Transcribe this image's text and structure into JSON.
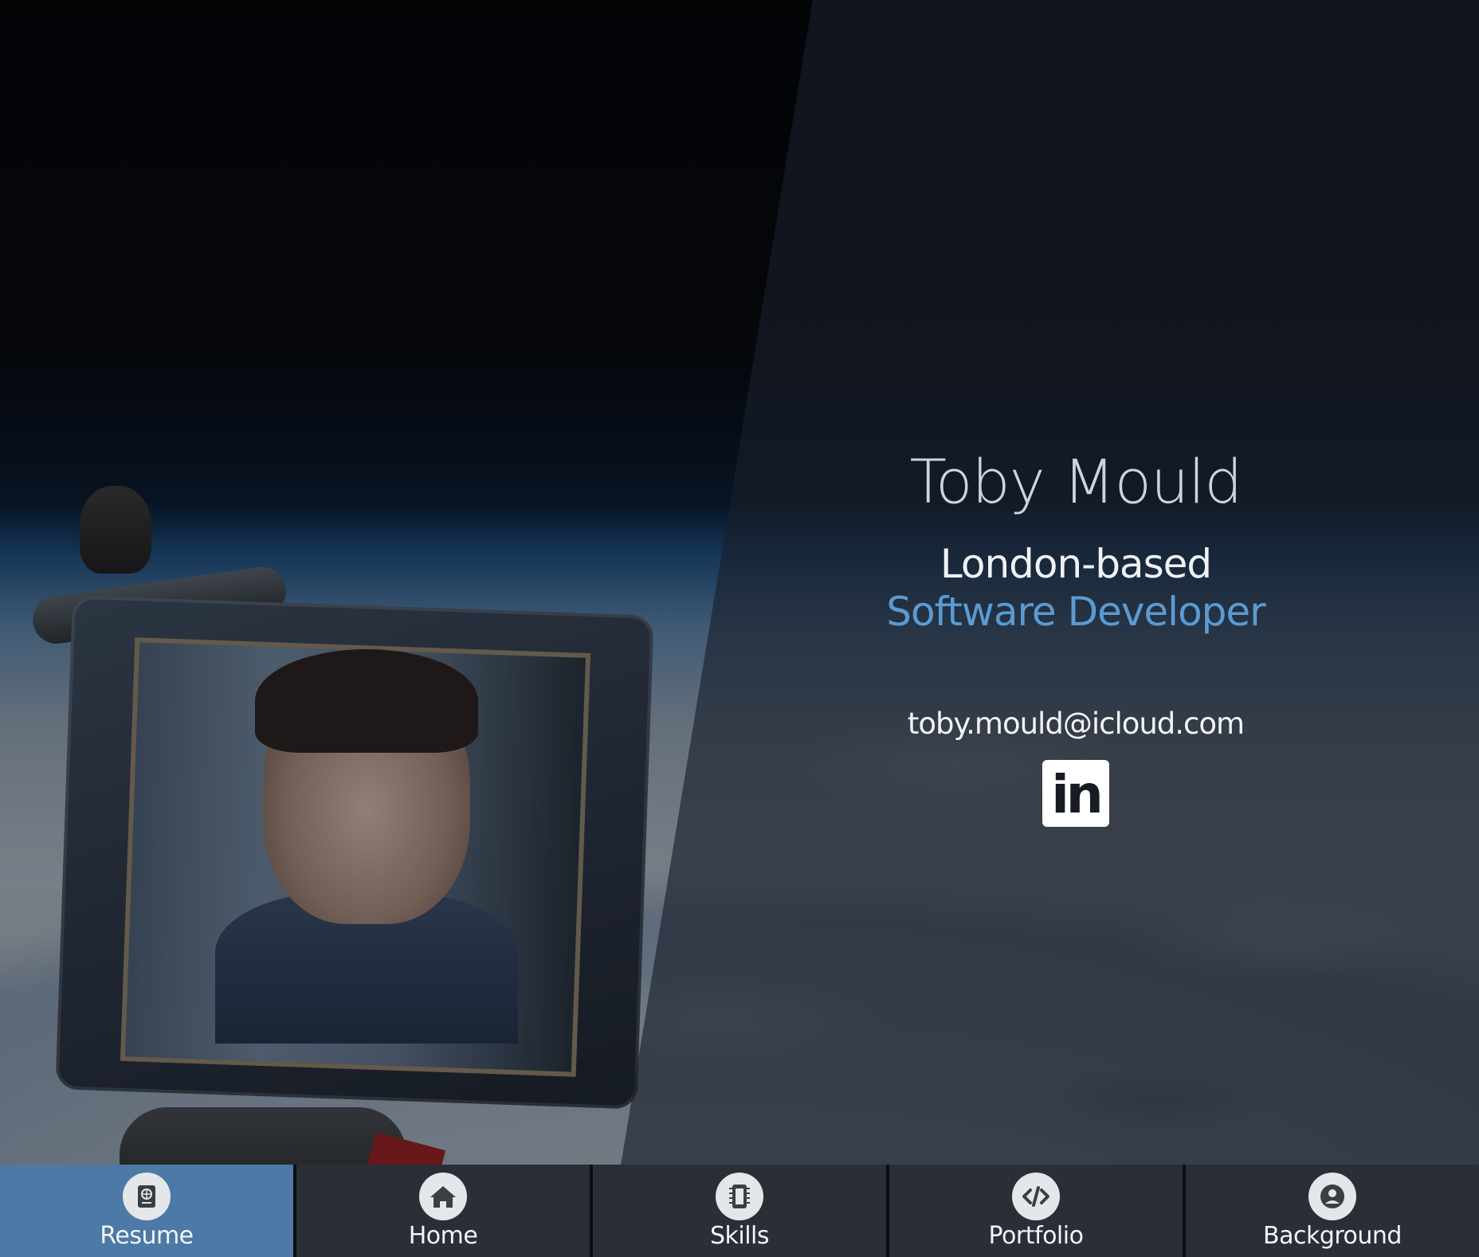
{
  "profile": {
    "name": "Toby Mould",
    "location": "London-based",
    "role": "Software Developer",
    "email": "toby.mould@icloud.com",
    "linkedin_text": "in"
  },
  "nav": {
    "items": [
      {
        "label": "Resume",
        "icon": "resume-icon",
        "active": true
      },
      {
        "label": "Home",
        "icon": "home-icon",
        "active": false
      },
      {
        "label": "Skills",
        "icon": "chip-icon",
        "active": false
      },
      {
        "label": "Portfolio",
        "icon": "code-icon",
        "active": false
      },
      {
        "label": "Background",
        "icon": "user-circle-icon",
        "active": false
      }
    ]
  },
  "colors": {
    "accent": "#5b9bd3",
    "nav_active": "#4c79a5",
    "nav_background": "#2a2f37"
  }
}
